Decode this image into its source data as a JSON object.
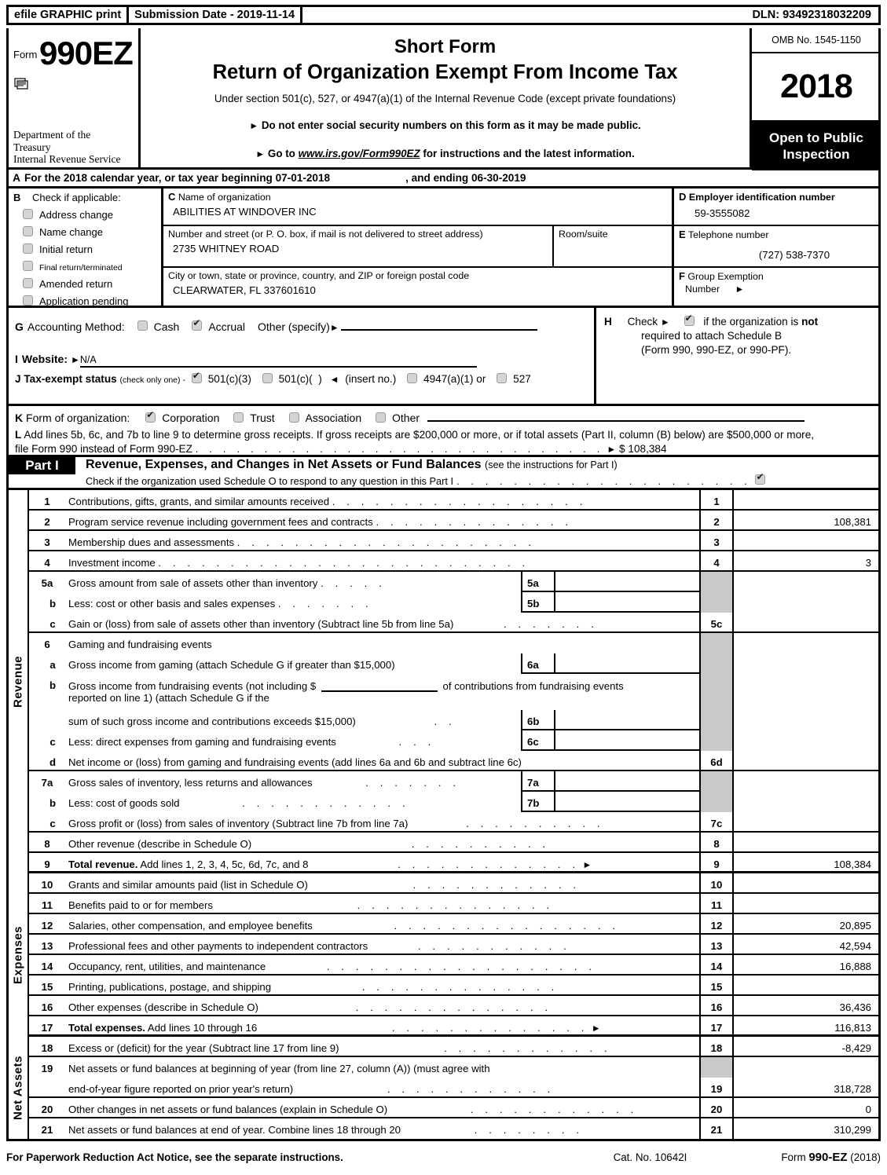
{
  "efile": {
    "graphic_print": "efile GRAPHIC print",
    "submission_date": "Submission Date - 2019-11-14",
    "dln": "DLN: 93492318032209"
  },
  "masthead": {
    "form_word": "Form",
    "form_number": "990EZ",
    "department": "Department of the\nTreasury\nInternal Revenue Service",
    "short_form": "Short Form",
    "title": "Return of Organization Exempt From Income Tax",
    "under_section": "Under section 501(c), 527, or 4947(a)(1) of the Internal Revenue Code (except private foundations)",
    "bullet1": "Do not enter social security numbers on this form as it may be made public.",
    "bullet2_pre": "Go to",
    "bullet2_link": "www.irs.gov/Form990EZ",
    "bullet2_post": "for instructions and the latest information.",
    "omb": "OMB No. 1545-1150",
    "year": "2018",
    "open_line1": "Open to Public",
    "open_line2": "Inspection"
  },
  "section_a": {
    "letter": "A",
    "text": "For the 2018 calendar year, or tax year beginning 07-01-2018",
    "ending": ", and ending 06-30-2019"
  },
  "section_b": {
    "letter": "B",
    "head": "Check if applicable:",
    "items": [
      {
        "label": "Address change",
        "checked": false
      },
      {
        "label": "Name change",
        "checked": false
      },
      {
        "label": "Initial return",
        "checked": false
      },
      {
        "label": "Final return/terminated",
        "checked": false
      },
      {
        "label": "Amended return",
        "checked": false
      },
      {
        "label": "Application pending",
        "checked": false
      }
    ]
  },
  "section_c": {
    "letter": "C",
    "name_label": "Name of organization",
    "name_value": "ABILITIES AT WINDOVER INC",
    "street_label": "Number and street (or P. O. box, if mail is not delivered to street address)",
    "street_value": "2735 WHITNEY ROAD",
    "room_label": "Room/suite",
    "room_value": "",
    "city_label": "City or town, state or province, country, and ZIP or foreign postal code",
    "city_value": "CLEARWATER, FL   337601610"
  },
  "section_d": {
    "letter": "D",
    "label": "Employer identification number",
    "value": "59-3555082"
  },
  "section_e": {
    "letter": "E",
    "label": "Telephone number",
    "value": "(727) 538-7370"
  },
  "section_f": {
    "letter": "F",
    "label": "Group Exemption",
    "label2": "Number",
    "value": ""
  },
  "section_g": {
    "letter": "G",
    "label": "Accounting Method:",
    "cash": "Cash",
    "cash_checked": false,
    "accrual": "Accrual",
    "accrual_checked": true,
    "other": "Other (specify)",
    "other_value": ""
  },
  "section_h": {
    "letter": "H",
    "line1_pre": "Check",
    "line1_post_a": "if the organization is",
    "line1_post_b": "not",
    "checked": true,
    "line2": "required to attach Schedule B",
    "line3": "(Form 990, 990-EZ, or 990-PF)."
  },
  "section_i": {
    "letter": "I",
    "label": "Website:",
    "value": "N/A"
  },
  "section_j": {
    "letter": "J",
    "title": "Tax-exempt status",
    "note": "(check only one) -",
    "opt1": "501(c)(3)",
    "opt1_checked": true,
    "opt2": "501(c)(",
    "opt2_checked": false,
    "opt2_after": ")",
    "insert_no": "(insert no.)",
    "opt3": "4947(a)(1) or",
    "opt3_checked": false,
    "opt4": "527",
    "opt4_checked": false
  },
  "section_k": {
    "letter": "K",
    "label": "Form of organization:",
    "options": [
      {
        "label": "Corporation",
        "checked": true
      },
      {
        "label": "Trust",
        "checked": false
      },
      {
        "label": "Association",
        "checked": false
      },
      {
        "label": "Other",
        "checked": false
      }
    ],
    "other_value": ""
  },
  "section_l": {
    "letter": "L",
    "line1": "Add lines 5b, 6c, and 7b to line 9 to determine gross receipts. If gross receipts are $200,000 or more, or if total assets (Part II, column (B) below) are $500,000 or more,",
    "line2": "file Form 990 instead of Form 990-EZ",
    "amount_prefix": "$",
    "amount": "108,384"
  },
  "part1": {
    "tab": "Part I",
    "title": "Revenue, Expenses, and Changes in Net Assets or Fund Balances",
    "title_sub": "(see the instructions for Part I)",
    "schedule_o_text": "Check if the organization used Schedule O to respond to any question in this Part I",
    "schedule_o_checked": true
  },
  "labels": {
    "revenue": "Revenue",
    "expenses": "Expenses",
    "net_assets": "Net Assets"
  },
  "revenue_rows": [
    {
      "no": "1",
      "desc": "Contributions, gifts, grants, and similar amounts received",
      "lineno": "1",
      "amount": ""
    },
    {
      "no": "2",
      "desc": "Program service revenue including government fees and contracts",
      "lineno": "2",
      "amount": "108,381"
    },
    {
      "no": "3",
      "desc": "Membership dues and assessments",
      "lineno": "3",
      "amount": ""
    },
    {
      "no": "4",
      "desc": "Investment income",
      "lineno": "4",
      "amount": "3"
    },
    {
      "no": "5a",
      "desc": "Gross amount from sale of assets other than inventory",
      "subno": "5a",
      "subval": ""
    },
    {
      "no": "b",
      "desc": "Less: cost or other basis and sales expenses",
      "subno": "5b",
      "subval": ""
    },
    {
      "no": "c",
      "desc": "Gain or (loss) from sale of assets other than inventory (Subtract line 5b from line 5a)",
      "lineno": "5c",
      "amount": ""
    },
    {
      "no": "6",
      "desc": "Gaming and fundraising events"
    },
    {
      "no": "a",
      "desc": "Gross income from gaming (attach Schedule G if greater than $15,000)",
      "subno": "6a",
      "subval": ""
    },
    {
      "no": "b",
      "desc_part1": "Gross income from fundraising events (not including $",
      "desc_part2": "of contributions from fundraising events",
      "desc_part3": "reported on line 1) (attach Schedule G if the"
    },
    {
      "no": "",
      "desc": "sum of such gross income and contributions exceeds $15,000)",
      "subno": "6b",
      "subval": ""
    },
    {
      "no": "c",
      "desc": "Less: direct expenses from gaming and fundraising events",
      "subno": "6c",
      "subval": ""
    },
    {
      "no": "d",
      "desc": "Net income or (loss) from gaming and fundraising events (add lines 6a and 6b and subtract line 6c)",
      "lineno": "6d",
      "amount": ""
    },
    {
      "no": "7a",
      "desc": "Gross sales of inventory, less returns and allowances",
      "subno": "7a",
      "subval": ""
    },
    {
      "no": "b",
      "desc": "Less: cost of goods sold",
      "subno": "7b",
      "subval": ""
    },
    {
      "no": "c",
      "desc": "Gross profit or (loss) from sales of inventory (Subtract line 7b from line 7a)",
      "lineno": "7c",
      "amount": ""
    },
    {
      "no": "8",
      "desc": "Other revenue (describe in Schedule O)",
      "lineno": "8",
      "amount": ""
    },
    {
      "no": "9",
      "desc_bold": "Total revenue.",
      "desc": "Add lines 1, 2, 3, 4, 5c, 6d, 7c, and 8",
      "lineno": "9",
      "amount": "108,384"
    }
  ],
  "expense_rows": [
    {
      "no": "10",
      "desc": "Grants and similar amounts paid (list in Schedule O)",
      "lineno": "10",
      "amount": ""
    },
    {
      "no": "11",
      "desc": "Benefits paid to or for members",
      "lineno": "11",
      "amount": ""
    },
    {
      "no": "12",
      "desc": "Salaries, other compensation, and employee benefits",
      "lineno": "12",
      "amount": "20,895"
    },
    {
      "no": "13",
      "desc": "Professional fees and other payments to independent contractors",
      "lineno": "13",
      "amount": "42,594"
    },
    {
      "no": "14",
      "desc": "Occupancy, rent, utilities, and maintenance",
      "lineno": "14",
      "amount": "16,888"
    },
    {
      "no": "15",
      "desc": "Printing, publications, postage, and shipping",
      "lineno": "15",
      "amount": ""
    },
    {
      "no": "16",
      "desc": "Other expenses (describe in Schedule O)",
      "lineno": "16",
      "amount": "36,436"
    },
    {
      "no": "17",
      "desc_bold": "Total expenses.",
      "desc": "Add lines 10 through 16",
      "lineno": "17",
      "amount": "116,813"
    }
  ],
  "netasset_rows": [
    {
      "no": "18",
      "desc": "Excess or (deficit) for the year (Subtract line 17 from line 9)",
      "lineno": "18",
      "amount": "-8,429"
    },
    {
      "no": "19",
      "desc": "Net assets or fund balances at beginning of year (from line 27, column (A)) (must agree with"
    },
    {
      "no": "",
      "desc": "end-of-year figure reported on prior year's return)",
      "lineno": "19",
      "amount": "318,728"
    },
    {
      "no": "20",
      "desc": "Other changes in net assets or fund balances (explain in Schedule O)",
      "lineno": "20",
      "amount": "0"
    },
    {
      "no": "21",
      "desc": "Net assets or fund balances at end of year. Combine lines 18 through 20",
      "lineno": "21",
      "amount": "310,299"
    }
  ],
  "footer": {
    "left": "For Paperwork Reduction Act Notice, see the separate instructions.",
    "cat": "Cat. No. 10642I",
    "right_pre": "Form",
    "right_bold": "990-EZ",
    "right_post": "(2018)"
  }
}
